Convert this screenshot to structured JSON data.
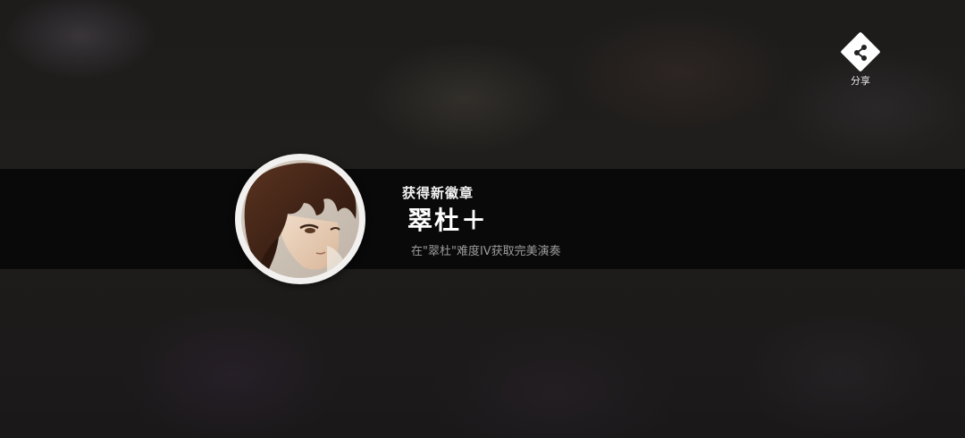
{
  "share": {
    "icon": "share-icon",
    "label": "分享"
  },
  "badge": {
    "notice": "获得新徽章",
    "name": "翠杜＋",
    "description": "在\"翠杜\"难度IV获取完美演奏",
    "image": "character-portrait"
  }
}
